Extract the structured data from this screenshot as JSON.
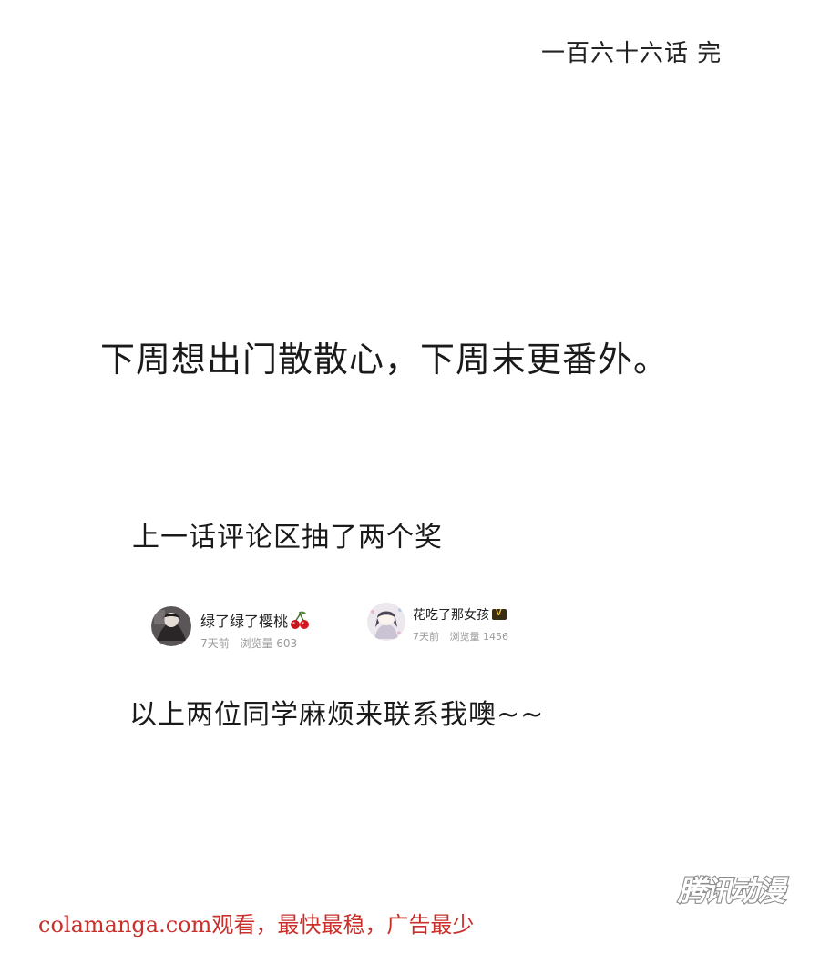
{
  "chapter_end": "一百六十六话 完",
  "notice": "下周想出门散散心，下周末更番外。",
  "lottery_text": "上一话评论区抽了两个奖",
  "winners": [
    {
      "name": "绿了绿了樱桃",
      "time": "7天前",
      "views": "浏览量 603",
      "badge_icon": "cherry-icon"
    },
    {
      "name": "花吃了那女孩",
      "time": "7天前",
      "views": "浏览量 1456",
      "badge_icon": "vip-badge-icon"
    }
  ],
  "contact_text": "以上两位同学麻烦来联系我噢~~",
  "watermark": "腾讯动漫",
  "site_banner": "colamanga.com观看，最快最稳，广告最少",
  "colors": {
    "banner_red": "#c9302c",
    "meta_gray": "#9a9a9a",
    "text": "#1a1a1a"
  }
}
